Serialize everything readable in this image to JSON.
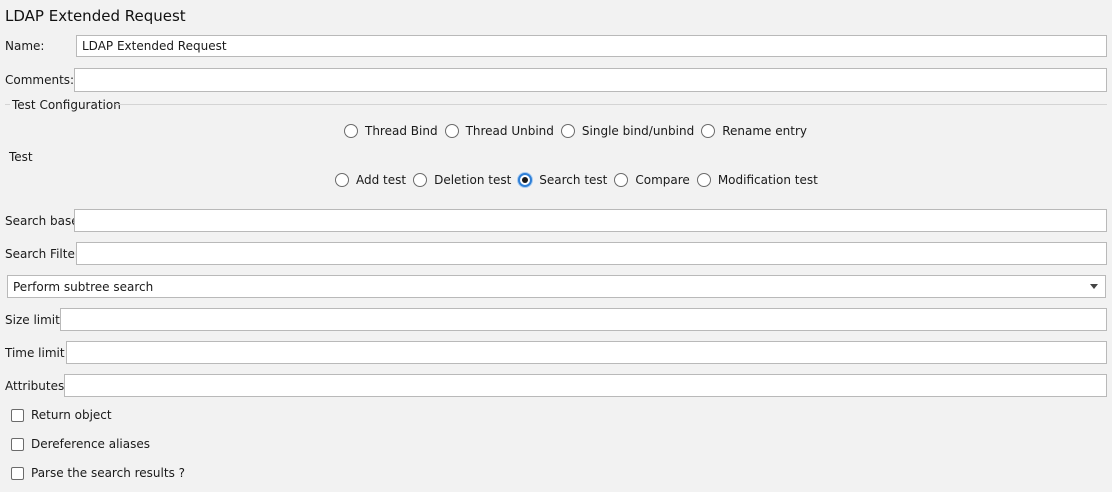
{
  "title": "LDAP Extended Request",
  "name": {
    "label": "Name:",
    "value": "LDAP Extended Request"
  },
  "comments": {
    "label": "Comments:",
    "value": ""
  },
  "test_configuration": {
    "legend": "Test Configuration"
  },
  "operation_options": [
    {
      "label": "Thread Bind",
      "selected": false
    },
    {
      "label": "Thread Unbind",
      "selected": false
    },
    {
      "label": "Single bind/unbind",
      "selected": false
    },
    {
      "label": "Rename entry",
      "selected": false
    }
  ],
  "test": {
    "label": "Test"
  },
  "test_options": [
    {
      "label": "Add test",
      "selected": false
    },
    {
      "label": "Deletion test",
      "selected": false
    },
    {
      "label": "Search test",
      "selected": true
    },
    {
      "label": "Compare",
      "selected": false
    },
    {
      "label": "Modification test",
      "selected": false
    }
  ],
  "search_base": {
    "label": "Search base",
    "value": ""
  },
  "search_filter": {
    "label": "Search Filter",
    "value": ""
  },
  "scope_select": {
    "value": "Perform subtree search"
  },
  "size_limit": {
    "label": "Size limit",
    "value": ""
  },
  "time_limit": {
    "label": "Time limit",
    "value": ""
  },
  "attributes": {
    "label": "Attributes",
    "value": ""
  },
  "checkboxes": [
    {
      "label": "Return object",
      "checked": false
    },
    {
      "label": "Dereference aliases",
      "checked": false
    },
    {
      "label": "Parse the search results ?",
      "checked": false
    }
  ],
  "colors": {
    "background": "#f2f2f2",
    "field_border": "#b9b9b9",
    "selected_radio": "#2f7fd6"
  }
}
